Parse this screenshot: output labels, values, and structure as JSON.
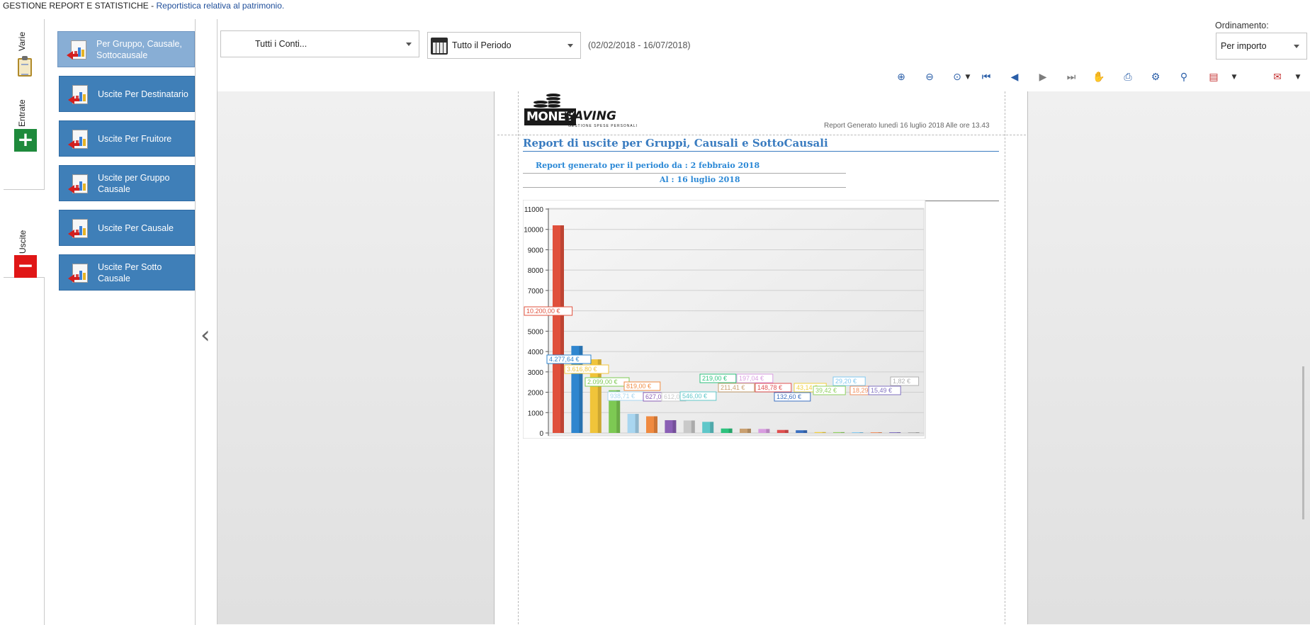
{
  "window": {
    "title": "GESTIONE REPORT E STATISTICHE",
    "separator": " - ",
    "subtitle": "Reportistica relativa al patrimonio."
  },
  "side_tabs": [
    {
      "label": "Varie",
      "icon": "clipboard-icon"
    },
    {
      "label": "Entrate",
      "icon": "plus-icon"
    },
    {
      "label": "Uscite",
      "icon": "minus-icon",
      "active": true
    }
  ],
  "reports": [
    {
      "label": "Per Gruppo, Causale, Sottocausale",
      "selected": true
    },
    {
      "label": "Uscite Per Destinatario"
    },
    {
      "label": "Uscite Per Fruitore"
    },
    {
      "label": "Uscite per Gruppo Causale"
    },
    {
      "label": "Uscite Per Causale"
    },
    {
      "label": "Uscite Per Sotto Causale"
    }
  ],
  "filters": {
    "accounts": "Tutti i Conti...",
    "period": "Tutto il Periodo",
    "range": "(02/02/2018 - 16/07/2018)",
    "sort_label": "Ordinamento:",
    "sort_value": "Per importo"
  },
  "toolbar_icons": [
    "zoom-in-icon",
    "zoom-out-icon",
    "zoom-menu-icon",
    "first-page-icon",
    "previous-page-icon",
    "next-page-icon",
    "last-page-icon",
    "hand-tool-icon",
    "print-icon",
    "page-setup-icon",
    "find-icon",
    "export-icon",
    "export-dropdown-icon",
    "send-icon",
    "send-dropdown-icon"
  ],
  "report": {
    "logo_word1": "MONEY",
    "logo_word2": "SAVING",
    "logo_tagline": "GESTIONE SPESE PERSONALI",
    "generated": "Report Generato lunedì 16 luglio 2018 Alle ore 13.43",
    "title": "Report di uscite per Gruppi, Causali e SottoCausali",
    "period_from": "Report generato per il periodo da : 2 febbraio 2018",
    "period_to": "Al : 16 luglio 2018"
  },
  "chart_data": {
    "type": "bar",
    "title": "",
    "xlabel": "",
    "ylabel": "",
    "ylim": [
      0,
      11000
    ],
    "yticks": [
      0,
      1000,
      2000,
      3000,
      4000,
      5000,
      6000,
      7000,
      8000,
      9000,
      10000,
      11000
    ],
    "grid": true,
    "values": [
      10200.0,
      4277.64,
      3616.8,
      2099.0,
      938.71,
      819.0,
      627.0,
      612.0,
      546.0,
      219.0,
      211.41,
      197.04,
      148.78,
      132.6,
      43.14,
      39.42,
      29.2,
      18.29,
      15.49,
      1.82
    ],
    "data_labels": [
      "10.200,00 €",
      "4.277,64 €",
      "3.616,80 €",
      "2.099,00 €",
      "938,71 €",
      "819,00 €",
      "627,0",
      "612,0",
      "546,00 €",
      "219,00 €",
      "211,41 €",
      "197,04 €",
      "148,78 €",
      "132,60 €",
      "43,14 €",
      "39,42 €",
      "29,20 €",
      "18,29 €",
      "15,49 €",
      "1,82 €"
    ],
    "colors": [
      "#e0503c",
      "#2f86cf",
      "#f0c43a",
      "#7dc953",
      "#a9d6f0",
      "#f08a40",
      "#8a5fb5",
      "#c9c9c9",
      "#5fc7c9",
      "#2ec27e",
      "#c9a070",
      "#d89ce0",
      "#e05050",
      "#3a6fc0",
      "#f0d040",
      "#90d060",
      "#80c8f0",
      "#f09060",
      "#8070c0",
      "#b0b0b0"
    ]
  }
}
